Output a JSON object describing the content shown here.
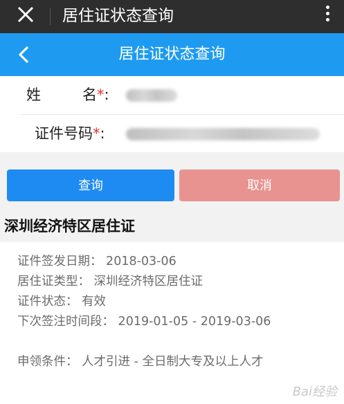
{
  "wechat_bar": {
    "title": "居住证状态查询"
  },
  "header": {
    "title": "居住证状态查询"
  },
  "form": {
    "name_label_a": "姓",
    "name_label_b": "名",
    "id_label": "证件号码",
    "required_mark": "*",
    "colon": ":"
  },
  "buttons": {
    "query": "查询",
    "cancel": "取消"
  },
  "result": {
    "section_title": "深圳经济特区居住证",
    "issue_date": "证件签发日期： 2018-03-06",
    "permit_type": "居住证类型： 深圳经济特区居住证",
    "status": "证件状态： 有效",
    "next_renewal": "下次签注时间段： 2019-01-05 - 2019-03-06",
    "eligibility": "申领条件： 人才引进 - 全日制大专及以上人才"
  },
  "watermark": "Bai经验",
  "colors": {
    "header_blue": "#1e9bf0",
    "query_blue": "#1e8bf2",
    "cancel_pink": "#e89390",
    "required_red": "#e5322d"
  }
}
